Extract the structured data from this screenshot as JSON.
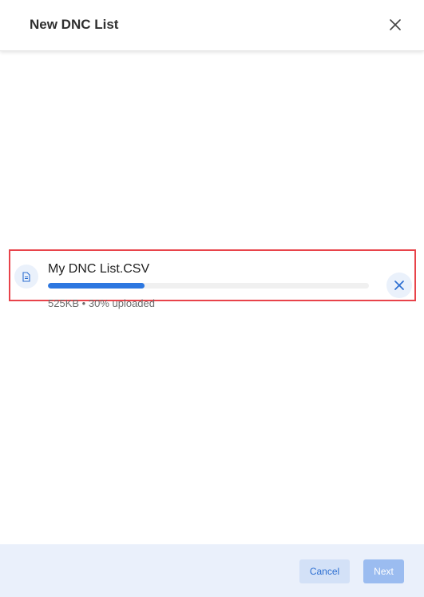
{
  "dialog": {
    "title": "New DNC List"
  },
  "upload": {
    "file_name": "My DNC List.CSV",
    "file_size": "525KB",
    "separator": "•",
    "status": "30% uploaded",
    "progress_percent": 30
  },
  "footer": {
    "cancel_label": "Cancel",
    "next_label": "Next"
  },
  "icons": {
    "close": "close-icon",
    "file": "file-document-icon",
    "remove": "remove-x-icon"
  },
  "colors": {
    "accent": "#2d77e0",
    "highlight_border": "#e8434a",
    "footer_bg": "#eaf0fb",
    "next_button_disabled": "#9bbcf0"
  }
}
